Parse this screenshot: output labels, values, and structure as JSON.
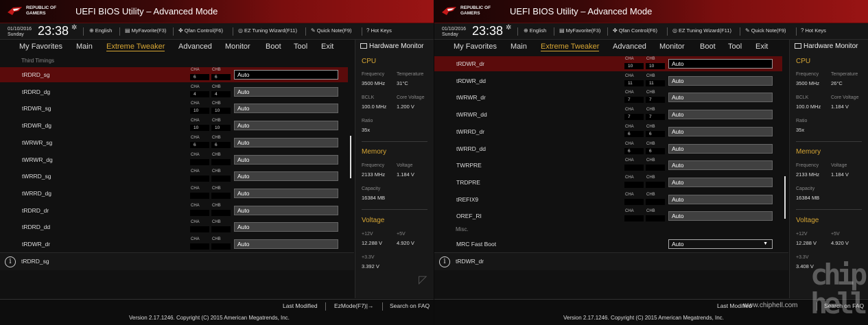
{
  "app_title": "UEFI BIOS Utility – Advanced Mode",
  "logo_text": "REPUBLIC OF\nGAMERS",
  "colors": {
    "accent": "#d7a634",
    "header_red": "#9a1414",
    "selected_row": "#5a0b0b"
  },
  "left": {
    "toolbar": {
      "date": "01/10/2016",
      "day": "Sunday",
      "time": "23:38",
      "language": "English",
      "myfavorite": "MyFavorite(F3)",
      "qfan": "Qfan Control(F6)",
      "ez_tuning": "EZ Tuning Wizard(F11)",
      "quick_note": "Quick Note(F9)",
      "hot_keys": "Hot Keys"
    },
    "nav": [
      "My Favorites",
      "Main",
      "Extreme Tweaker",
      "Advanced",
      "Monitor",
      "Boot",
      "Tool",
      "Exit"
    ],
    "active_tab": "Extreme Tweaker",
    "section": "Third Timings",
    "rows": [
      {
        "label": "tRDRD_sg",
        "cha": "6",
        "chb": "6",
        "value": "Auto"
      },
      {
        "label": "tRDRD_dg",
        "cha": "4",
        "chb": "4",
        "value": "Auto"
      },
      {
        "label": "tRDWR_sg",
        "cha": "10",
        "chb": "10",
        "value": "Auto"
      },
      {
        "label": "tRDWR_dg",
        "cha": "10",
        "chb": "10",
        "value": "Auto"
      },
      {
        "label": "tWRWR_sg",
        "cha": "6",
        "chb": "6",
        "value": "Auto"
      },
      {
        "label": "tWRWR_dg",
        "cha": "",
        "chb": "",
        "value": "Auto"
      },
      {
        "label": "tWRRD_sg",
        "cha": "",
        "chb": "",
        "value": "Auto"
      },
      {
        "label": "tWRRD_dg",
        "cha": "",
        "chb": "",
        "value": "Auto"
      },
      {
        "label": "tRDRD_dr",
        "cha": "",
        "chb": "",
        "value": "Auto"
      },
      {
        "label": "tRDRD_dd",
        "cha": "",
        "chb": "",
        "value": "Auto"
      },
      {
        "label": "tRDWR_dr",
        "cha": "",
        "chb": "",
        "value": "Auto"
      }
    ],
    "cha_label": "CHA",
    "chb_label": "CHB",
    "help_text": "tRDRD_sg",
    "hw": {
      "title": "Hardware Monitor",
      "cpu": "CPU",
      "frequency_label": "Frequency",
      "frequency": "3500 MHz",
      "temperature_label": "Temperature",
      "temperature": "31°C",
      "bclk_label": "BCLK",
      "bclk": "100.0 MHz",
      "core_voltage_label": "Core Voltage",
      "core_voltage": "1.200 V",
      "ratio_label": "Ratio",
      "ratio": "35x",
      "memory": "Memory",
      "mem_frequency_label": "Frequency",
      "mem_frequency": "2133 MHz",
      "mem_voltage_label": "Voltage",
      "mem_voltage": "1.184 V",
      "capacity_label": "Capacity",
      "capacity": "16384 MB",
      "voltage": "Voltage",
      "v12_label": "+12V",
      "v12": "12.288 V",
      "v5_label": "+5V",
      "v5": "4.920 V",
      "v33_label": "+3.3V",
      "v33": "3.392 V"
    },
    "footer": {
      "last_modified": "Last Modified",
      "ezmode": "EzMode(F7)|→",
      "search": "Search on FAQ",
      "version": "Version 2.17.1246. Copyright (C) 2015 American Megatrends, Inc."
    }
  },
  "right": {
    "toolbar": {
      "date": "01/10/2016",
      "day": "Sunday",
      "time": "23:38",
      "language": "English",
      "myfavorite": "MyFavorite(F3)",
      "qfan": "Qfan Control(F6)",
      "ez_tuning": "EZ Tuning Wizard(F11)",
      "quick_note": "Quick Note(F9)",
      "hot_keys": "Hot Keys"
    },
    "nav": [
      "My Favorites",
      "Main",
      "Extreme Tweaker",
      "Advanced",
      "Monitor",
      "Boot",
      "Tool",
      "Exit"
    ],
    "active_tab": "Extreme Tweaker",
    "rows": [
      {
        "label": "tRDWR_dr",
        "cha": "10",
        "chb": "10",
        "value": "Auto"
      },
      {
        "label": "tRDWR_dd",
        "cha": "11",
        "chb": "11",
        "value": "Auto"
      },
      {
        "label": "tWRWR_dr",
        "cha": "7",
        "chb": "7",
        "value": "Auto"
      },
      {
        "label": "tWRWR_dd",
        "cha": "7",
        "chb": "7",
        "value": "Auto"
      },
      {
        "label": "tWRRD_dr",
        "cha": "6",
        "chb": "6",
        "value": "Auto"
      },
      {
        "label": "tWRRD_dd",
        "cha": "6",
        "chb": "6",
        "value": "Auto"
      },
      {
        "label": "TWRPRE",
        "cha": "",
        "chb": "",
        "value": "Auto"
      },
      {
        "label": "TRDPRE",
        "cha": "",
        "chb": "",
        "value": "Auto"
      },
      {
        "label": "tREFIX9",
        "cha": "",
        "chb": "",
        "value": "Auto"
      },
      {
        "label": "OREF_RI",
        "cha": "",
        "chb": "",
        "value": "Auto"
      }
    ],
    "cha_label": "CHA",
    "chb_label": "CHB",
    "misc_label": "Misc.",
    "mrc_label": "MRC Fast Boot",
    "mrc_value": "Auto",
    "help_text": "tRDWR_dr",
    "hw": {
      "title": "Hardware Monitor",
      "cpu": "CPU",
      "frequency_label": "Frequency",
      "frequency": "3500 MHz",
      "temperature_label": "Temperature",
      "temperature": "26°C",
      "bclk_label": "BCLK",
      "bclk": "100.0 MHz",
      "core_voltage_label": "Core Voltage",
      "core_voltage": "1.184 V",
      "ratio_label": "Ratio",
      "ratio": "35x",
      "memory": "Memory",
      "mem_frequency_label": "Frequency",
      "mem_frequency": "2133 MHz",
      "mem_voltage_label": "Voltage",
      "mem_voltage": "1.184 V",
      "capacity_label": "Capacity",
      "capacity": "16384 MB",
      "voltage": "Voltage",
      "v12_label": "+12V",
      "v12": "12.288 V",
      "v5_label": "+5V",
      "v5": "4.920 V",
      "v33_label": "+3.3V",
      "v33": "3.408 V"
    },
    "footer": {
      "last_modified": "Last Modified",
      "search": "Search on FAQ",
      "version": "Version 2.17.1246. Copyright (C) 2015 American Megatrends, Inc."
    }
  },
  "watermark": {
    "url": "www.chiphell.com",
    "logo_text": "chip hell"
  }
}
